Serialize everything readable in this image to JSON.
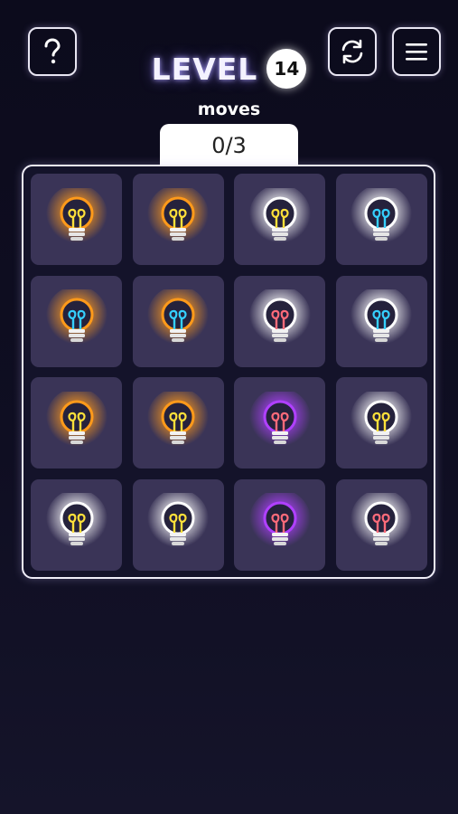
{
  "header": {
    "level_label": "LEVEL",
    "level_number": "14",
    "help_icon": "question-icon",
    "restart_icon": "refresh-icon",
    "menu_icon": "hamburger-menu-icon"
  },
  "moves": {
    "label": "moves",
    "value": "0/3"
  },
  "colors": {
    "glow_orange": "#ff9a1a",
    "glow_white": "#ffffff",
    "glow_purple": "#b040ff",
    "filament_yellow": "#ffe03a",
    "filament_blue": "#35d0ff",
    "filament_red": "#ff6b7a",
    "tile": "#3a3457",
    "bulb_glass": "#25223c"
  },
  "grid": [
    [
      {
        "glow": "orange",
        "filament": "yellow"
      },
      {
        "glow": "orange",
        "filament": "yellow"
      },
      {
        "glow": "white",
        "filament": "yellow"
      },
      {
        "glow": "white",
        "filament": "blue"
      }
    ],
    [
      {
        "glow": "orange",
        "filament": "blue"
      },
      {
        "glow": "orange",
        "filament": "blue"
      },
      {
        "glow": "white",
        "filament": "red"
      },
      {
        "glow": "white",
        "filament": "blue"
      }
    ],
    [
      {
        "glow": "orange",
        "filament": "yellow"
      },
      {
        "glow": "orange",
        "filament": "yellow"
      },
      {
        "glow": "purple",
        "filament": "red"
      },
      {
        "glow": "white",
        "filament": "yellow"
      }
    ],
    [
      {
        "glow": "white",
        "filament": "yellow"
      },
      {
        "glow": "white",
        "filament": "yellow"
      },
      {
        "glow": "purple",
        "filament": "red"
      },
      {
        "glow": "white",
        "filament": "red"
      }
    ]
  ]
}
